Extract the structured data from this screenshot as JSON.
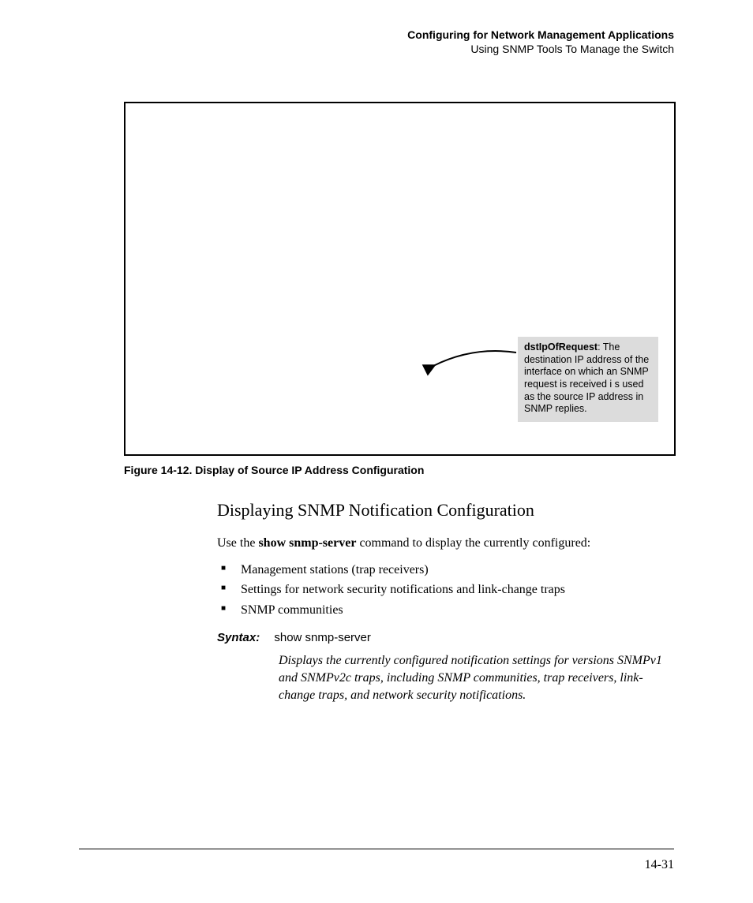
{
  "header": {
    "line1": "Configuring for Network Management Applications",
    "line2": "Using SNMP Tools To Manage the Switch"
  },
  "figure": {
    "callout_bold": "dstIpOfRequest",
    "callout_rest": ": The destination IP address of the interface on which an SNMP request is received i s used as the source IP address in SNMP replies.",
    "caption": "Figure 14-12.  Display of Source IP Address Configuration"
  },
  "section": {
    "heading": "Displaying SNMP Notification Configuration",
    "intro_pre": "Use the ",
    "intro_bold": "show snmp-server",
    "intro_post": " command to display the currently configured:",
    "bullets": [
      "Management stations (trap receivers)",
      "Settings for network security notifications and link-change traps",
      "SNMP communities"
    ],
    "syntax_label": "Syntax:",
    "syntax_cmd": "show snmp-server",
    "syntax_desc": "Displays the currently configured notification settings for versions SNMPv1 and SNMPv2c traps, including SNMP communities, trap receivers, link-change traps, and network security notifications."
  },
  "footer": {
    "page_number": "14-31"
  }
}
